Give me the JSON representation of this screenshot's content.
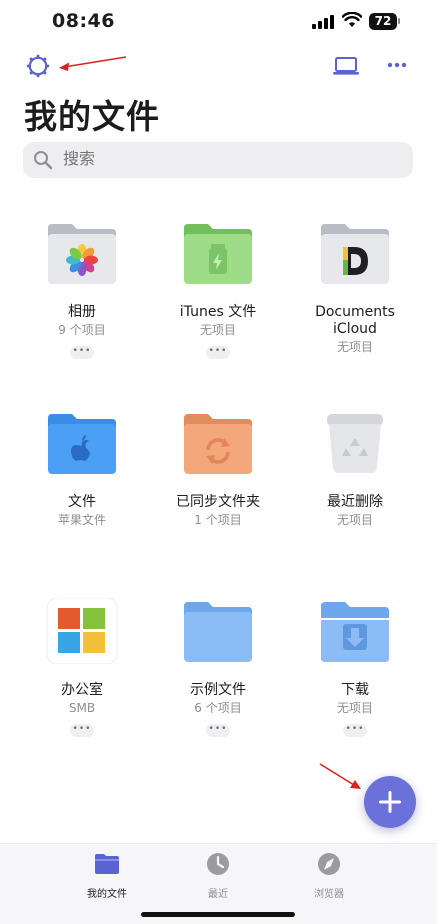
{
  "status": {
    "time": "08:46",
    "battery": "72"
  },
  "header": {
    "title": "我的文件"
  },
  "search": {
    "placeholder": "搜索"
  },
  "items": [
    {
      "name": "相册",
      "sub": "9 个项目",
      "more": "•••",
      "icon": "photos-folder-icon"
    },
    {
      "name": "iTunes 文件",
      "sub": "无项目",
      "more": "•••",
      "icon": "itunes-folder-icon"
    },
    {
      "name": "Documents\niCloud",
      "sub": "无项目",
      "more": "",
      "icon": "documents-icloud-folder-icon"
    },
    {
      "name": "文件",
      "sub": "苹果文件",
      "more": "",
      "icon": "apple-files-folder-icon"
    },
    {
      "name": "已同步文件夹",
      "sub": "1 个项目",
      "more": "",
      "icon": "sync-folder-icon"
    },
    {
      "name": "最近删除",
      "sub": "无项目",
      "more": "",
      "icon": "trash-icon"
    },
    {
      "name": "办公室",
      "sub": "SMB",
      "more": "•••",
      "icon": "smb-office-icon"
    },
    {
      "name": "示例文件",
      "sub": "6 个项目",
      "more": "•••",
      "icon": "sample-folder-icon"
    },
    {
      "name": "下载",
      "sub": "无项目",
      "more": "•••",
      "icon": "downloads-folder-icon"
    }
  ],
  "tabs": [
    {
      "label": "我的文件",
      "icon": "folder-icon",
      "active": true
    },
    {
      "label": "最近",
      "icon": "clock-icon",
      "active": false
    },
    {
      "label": "浏览器",
      "icon": "compass-icon",
      "active": false
    }
  ],
  "colors": {
    "accent": "#6a72d9",
    "folder_blue": "#7db2f3",
    "folder_green": "#8fd47d",
    "folder_orange": "#f0a878"
  }
}
